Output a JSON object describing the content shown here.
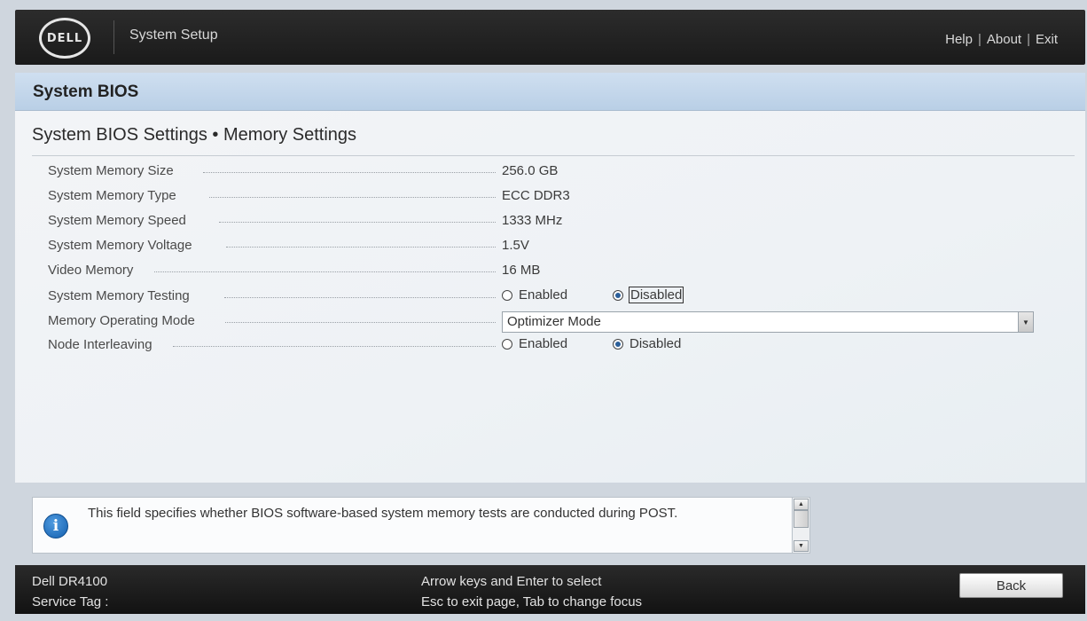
{
  "header": {
    "logo_text": "DELL",
    "app_title": "System Setup",
    "links": [
      "Help",
      "About",
      "Exit"
    ],
    "separator": "|"
  },
  "panel": {
    "title": "System BIOS",
    "subtitle": "System BIOS Settings • Memory Settings"
  },
  "settings": [
    {
      "label": "System Memory Size",
      "value": "256.0 GB"
    },
    {
      "label": "System Memory Type",
      "value": "ECC DDR3"
    },
    {
      "label": "System Memory Speed",
      "value": "1333 MHz"
    },
    {
      "label": "System Memory Voltage",
      "value": "1.5V"
    },
    {
      "label": "Video Memory",
      "value": "16 MB"
    },
    {
      "label": "System Memory Testing",
      "options": [
        "Enabled",
        "Disabled"
      ],
      "selected": "Disabled"
    },
    {
      "label": "Memory Operating Mode",
      "value": "Optimizer Mode"
    },
    {
      "label": "Node Interleaving",
      "options": [
        "Enabled",
        "Disabled"
      ],
      "selected": "Disabled"
    }
  ],
  "help": {
    "icon": "info-icon",
    "text": "This field specifies whether BIOS software-based system memory tests are conducted during POST."
  },
  "footer": {
    "model": "Dell DR4100",
    "service_tag_label": "Service Tag :",
    "hint_1": "Arrow keys and Enter to select",
    "hint_2": "Esc to exit page, Tab to change focus",
    "back_label": "Back"
  },
  "colors": {
    "topbar": "#1f1f1f",
    "panel_header": "#c4d7ec",
    "radio_selected": "#2b5f9a",
    "info_icon": "#1a6bbf"
  }
}
